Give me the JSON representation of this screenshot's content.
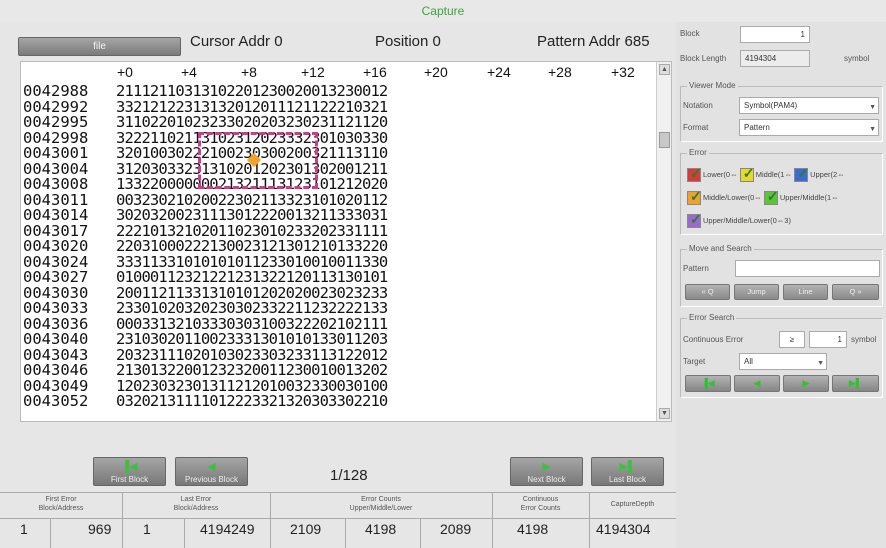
{
  "title": "Capture",
  "header": {
    "file_label": "file",
    "cursor_addr": "Cursor Addr 0",
    "position": "Position 0",
    "pattern_addr": "Pattern Addr 685"
  },
  "offsets": [
    "+0",
    "+4",
    "+8",
    "+12",
    "+16",
    "+20",
    "+24",
    "+28",
    "+32"
  ],
  "rows": [
    {
      "addr": "0042988",
      "data": "21112110313102201230020013230012"
    },
    {
      "addr": "0042992",
      "data": "33212122313132012011121122210321"
    },
    {
      "addr": "0042995",
      "data": "31102201023233020203230231121120"
    },
    {
      "addr": "0042998",
      "data": "32221102113102312023332301030330"
    },
    {
      "addr": "0043001",
      "data": "32010030222100230300200321113110"
    },
    {
      "addr": "0043004",
      "data": "31203033231310201202301302001211"
    },
    {
      "addr": "0043008",
      "data": "13322000000021321113123101212020"
    },
    {
      "addr": "0043011",
      "data": "00323021020022302113323101020112"
    },
    {
      "addr": "0043014",
      "data": "30203200231113012220013211333031"
    },
    {
      "addr": "0043017",
      "data": "22210132102011023010233202331111"
    },
    {
      "addr": "0043020",
      "data": "22031000222130023121301210133220"
    },
    {
      "addr": "0043024",
      "data": "33311331010101011233010010011330"
    },
    {
      "addr": "0043027",
      "data": "01000112321221231322120113130101"
    },
    {
      "addr": "0043030",
      "data": "20011211331310101202020023023233"
    },
    {
      "addr": "0043033",
      "data": "23301020320230302332211232222133"
    },
    {
      "addr": "0043036",
      "data": "00033132103330303100322202102111"
    },
    {
      "addr": "0043040",
      "data": "23103020110023331301010133011203"
    },
    {
      "addr": "0043043",
      "data": "20323111020103023303233113122012"
    },
    {
      "addr": "0043046",
      "data": "21301322001232320011230010013202"
    },
    {
      "addr": "0043049",
      "data": "12023032301311212010032330030100"
    },
    {
      "addr": "0043052",
      "data": "03202131111012223321320303302210"
    }
  ],
  "nav": {
    "first_block": "First Block",
    "previous_block": "Previous Block",
    "page": "1/128",
    "next_block": "Next Block",
    "last_block": "Last Block"
  },
  "stats": {
    "headers": [
      "First Error\nBlock/Address",
      "Last Error\nBlock/Address",
      "Error Counts\nUpper/Middle/Lower",
      "Continuous\nError Counts",
      "CaptureDepth"
    ],
    "values": [
      "1",
      "969",
      "1",
      "4194249",
      "2109",
      "4198",
      "2089",
      "4198",
      "4194304"
    ]
  },
  "side": {
    "block_label": "Block",
    "block_value": "1",
    "block_length_label": "Block Length",
    "block_length_value": "4194304",
    "block_length_unit": "symbol",
    "viewer_mode_title": "Viewer Mode",
    "notation_label": "Notation",
    "notation_value": "Symbol(PAM4)",
    "format_label": "Format",
    "format_value": "Pattern",
    "error_title": "Error",
    "err_lower": "Lower(0⇔",
    "err_middle": "Middle(1⇔",
    "err_upper": "Upper(2⇔",
    "err_middle_lower": "Middle/Lower(0⇔",
    "err_upper_middle": "Upper/Middle(1⇔",
    "err_all": "Upper/Middle/Lower(0⇔3)",
    "move_search_title": "Move and Search",
    "pattern_label": "Pattern",
    "prev_search_label": "« Q",
    "jump_label": "Jump",
    "line_label": "Line",
    "next_search_label": "Q »",
    "error_search_title": "Error Search",
    "continuous_error_label": "Continuous Error",
    "ge_symbol": "≥",
    "continuous_value": "1",
    "continuous_unit": "symbol",
    "target_label": "Target",
    "target_value": "All"
  },
  "colors": {
    "accent_green": "#3aa63a",
    "selection": "#cc3b8c",
    "error_orange": "#f2a32d",
    "err_red": "#d83a3a",
    "err_yellow": "#e8d82a",
    "err_blue": "#3a6ad8",
    "err_orange": "#f0a030",
    "err_green": "#5ac43a",
    "err_purple": "#9a6ad0"
  }
}
